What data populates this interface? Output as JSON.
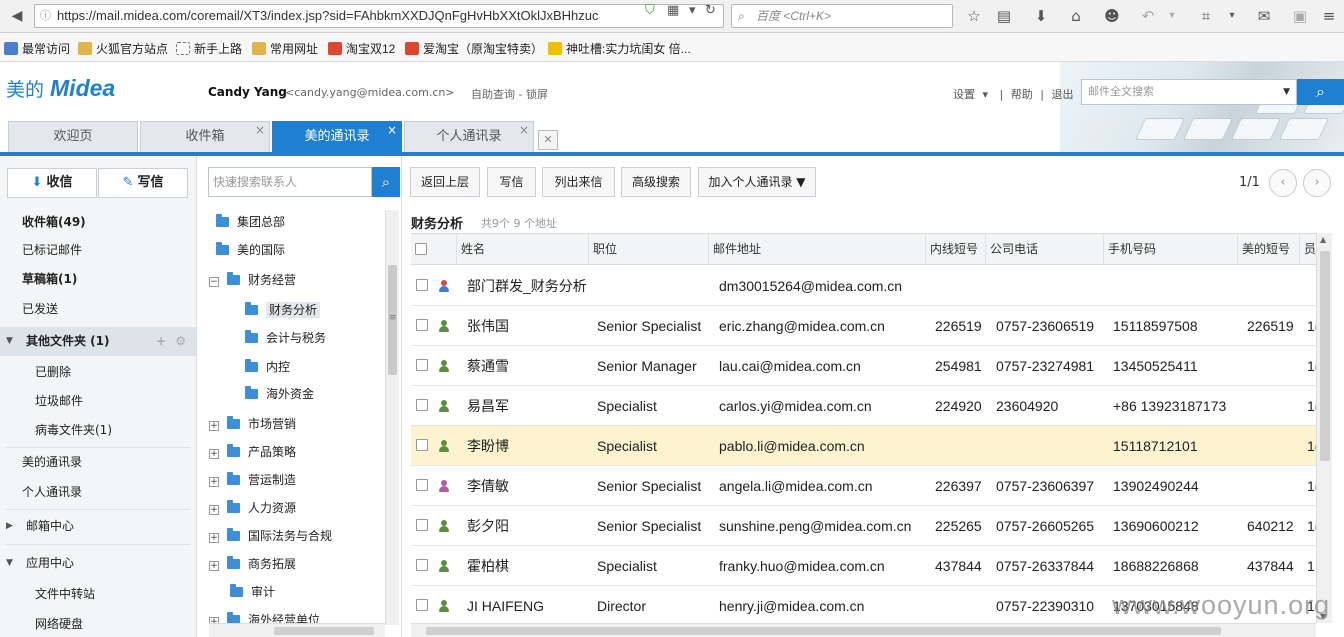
{
  "browser": {
    "url": "https://mail.midea.com/coremail/XT3/index.jsp?sid=FAhbkmXXDJQnFgHvHbXXtOklJxBHhzuc",
    "search_placeholder": "百度 <Ctrl+K>"
  },
  "bookmarks": [
    {
      "label": "最常访问",
      "color": "#4a7fd0"
    },
    {
      "label": "火狐官方站点",
      "color": "#e3b44a"
    },
    {
      "label": "新手上路",
      "color": "#ffffff"
    },
    {
      "label": "常用网址",
      "color": "#e3b44a"
    },
    {
      "label": "淘宝双12",
      "color": "#e0452f"
    },
    {
      "label": "爱淘宝（原淘宝特卖）",
      "color": "#e0452f"
    },
    {
      "label": "神吐槽:实力坑闺女 倍...",
      "color": "#f0c000"
    }
  ],
  "header": {
    "logo_cn": "美的",
    "logo_en": "Midea",
    "user_name": "Candy Yang",
    "user_email": "<candy.yang@midea.com.cn>",
    "self_service": "自助查询",
    "lock": "锁屏",
    "settings": "设置",
    "help": "帮助",
    "logout": "退出",
    "search_placeholder": "邮件全文搜索"
  },
  "tabs": [
    {
      "label": "欢迎页",
      "closable": false,
      "active": false
    },
    {
      "label": "收件箱",
      "closable": true,
      "active": false
    },
    {
      "label": "美的通讯录",
      "closable": true,
      "active": true
    },
    {
      "label": "个人通讯录",
      "closable": true,
      "active": false
    }
  ],
  "sidebar": {
    "receive": "收信",
    "compose": "写信",
    "items": [
      {
        "label": "收件箱(49)",
        "bold": true
      },
      {
        "label": "已标记邮件",
        "bold": false
      },
      {
        "label": "草稿箱(1)",
        "bold": true
      },
      {
        "label": "已发送",
        "bold": false
      },
      {
        "label": "其他文件夹 (1)",
        "bold": true
      },
      {
        "label": "已删除",
        "bold": false
      },
      {
        "label": "垃圾邮件",
        "bold": false
      },
      {
        "label": "病毒文件夹(1)",
        "bold": false
      },
      {
        "label": "美的通讯录",
        "bold": false
      },
      {
        "label": "个人通讯录",
        "bold": false
      },
      {
        "label": "邮箱中心",
        "bold": false
      },
      {
        "label": "应用中心",
        "bold": false
      },
      {
        "label": "文件中转站",
        "bold": false
      },
      {
        "label": "网络硬盘",
        "bold": false
      }
    ]
  },
  "tree": {
    "search_placeholder": "快速搜索联系人",
    "items": [
      {
        "label": "集团总部"
      },
      {
        "label": "美的国际"
      },
      {
        "label": "财务经营"
      },
      {
        "label": "财务分析"
      },
      {
        "label": "会计与税务"
      },
      {
        "label": "内控"
      },
      {
        "label": "海外资金"
      },
      {
        "label": "市场营销"
      },
      {
        "label": "产品策略"
      },
      {
        "label": "营运制造"
      },
      {
        "label": "人力资源"
      },
      {
        "label": "国际法务与合规"
      },
      {
        "label": "商务拓展"
      },
      {
        "label": "审计"
      },
      {
        "label": "海外经营单位"
      }
    ]
  },
  "toolbar": {
    "back": "返回上层",
    "write": "写信",
    "list_mail": "列出来信",
    "advanced": "高级搜索",
    "add_personal": "加入个人通讯录",
    "pager": "1/1"
  },
  "group": {
    "title": "财务分析",
    "count": "共9个 9 个地址"
  },
  "table": {
    "columns": [
      "姓名",
      "职位",
      "邮件地址",
      "内线短号",
      "公司电话",
      "手机号码",
      "美的短号",
      "员"
    ],
    "rows": [
      {
        "type": "group",
        "name": "部门群发_财务分析",
        "title": "",
        "email": "dm30015264@midea.com.cn",
        "ext": "",
        "phone": "",
        "mobile": "",
        "short": "",
        "extra": ""
      },
      {
        "type": "m",
        "name": "张伟国",
        "title": "Senior Specialist",
        "email": "eric.zhang@midea.com.cn",
        "ext": "226519",
        "phone": "0757-23606519",
        "mobile": "15118597508",
        "short": "226519",
        "extra": "1("
      },
      {
        "type": "m",
        "name": "蔡通雪",
        "title": "Senior Manager",
        "email": "lau.cai@midea.com.cn",
        "ext": "254981",
        "phone": "0757-23274981",
        "mobile": "13450525411",
        "short": "",
        "extra": "1("
      },
      {
        "type": "m",
        "name": "易昌军",
        "title": "Specialist",
        "email": "carlos.yi@midea.com.cn",
        "ext": "224920",
        "phone": "23604920",
        "mobile": "+86 13923187173",
        "short": "",
        "extra": "1("
      },
      {
        "type": "m",
        "name": "李盼博",
        "title": "Specialist",
        "email": "pablo.li@midea.com.cn",
        "ext": "",
        "phone": "",
        "mobile": "15118712101",
        "short": "",
        "extra": "1("
      },
      {
        "type": "f",
        "name": "李倩敏",
        "title": "Senior Specialist",
        "email": "angela.li@midea.com.cn",
        "ext": "226397",
        "phone": "0757-23606397",
        "mobile": "13902490244",
        "short": "",
        "extra": "1("
      },
      {
        "type": "m",
        "name": "彭夕阳",
        "title": "Senior Specialist",
        "email": "sunshine.peng@midea.com.cn",
        "ext": "225265",
        "phone": "0757-26605265",
        "mobile": "13690600212",
        "short": "640212",
        "extra": "1("
      },
      {
        "type": "m",
        "name": "霍柏棋",
        "title": "Specialist",
        "email": "franky.huo@midea.com.cn",
        "ext": "437844",
        "phone": "0757-26337844",
        "mobile": "18688226868",
        "short": "437844",
        "extra": "1"
      },
      {
        "type": "m",
        "name": "JI HAIFENG",
        "title": "Director",
        "email": "henry.ji@midea.com.cn",
        "ext": "",
        "phone": "0757-22390310",
        "mobile": "13703015848",
        "short": "",
        "extra": "1("
      }
    ],
    "highlight_row": 4
  },
  "watermark": "www.wooyun.org"
}
